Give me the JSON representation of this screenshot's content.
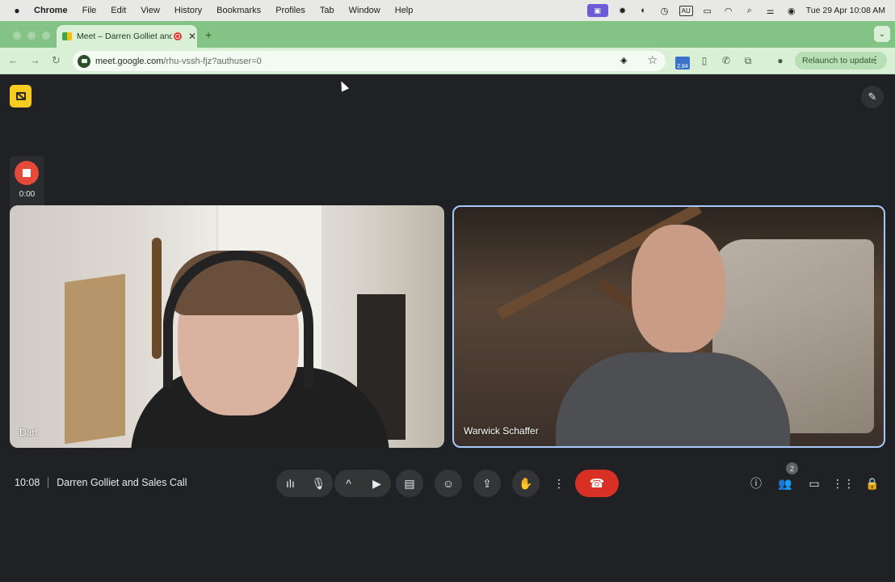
{
  "menubar": {
    "app": "Chrome",
    "items": [
      "File",
      "Edit",
      "View",
      "History",
      "Bookmarks",
      "Profiles",
      "Tab",
      "Window",
      "Help"
    ],
    "input_source": "AU",
    "datetime": "Tue 29 Apr  10:08 AM"
  },
  "tab": {
    "title": "Meet – Darren Golliet and",
    "close_glyph": "✕",
    "new_tab_glyph": "+"
  },
  "toolbar": {
    "url_host": "meet.google.com",
    "url_path": "/rhu-vssh-fjz?authuser=0",
    "extension_badge": "2.84",
    "relaunch_label": "Relaunch to update"
  },
  "recorder": {
    "elapsed": "0:00"
  },
  "participants": [
    {
      "name": "Dart"
    },
    {
      "name": "Warwick Schaffer"
    }
  ],
  "meeting": {
    "time": "10:08",
    "title": "Darren Golliet and Sales Call",
    "participant_count": "2"
  },
  "colors": {
    "accent_green": "#83c486",
    "end_call_red": "#d93025",
    "record_red": "#e5493a",
    "active_tile_border": "#a8c7fa",
    "yellow_button": "#f9cc1f"
  }
}
